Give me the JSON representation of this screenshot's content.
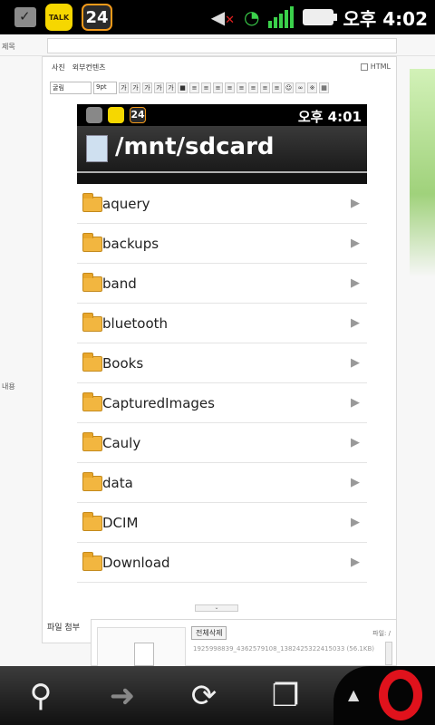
{
  "status_bar": {
    "clock": "오후 4:02",
    "icons": [
      "download-done-icon",
      "kakaotalk-icon",
      "news24-icon",
      "mute-icon",
      "wifi-icon",
      "signal-icon",
      "battery-icon"
    ],
    "talk_label": "TALK",
    "badge_24": "24"
  },
  "form": {
    "title_label": "제목",
    "content_label": "내용",
    "title_value": "",
    "editor_tabs": [
      "사진",
      "외부컨텐츠"
    ],
    "html_label": "HTML",
    "font_select": "굴림",
    "size_select": "9pt"
  },
  "embedded_screenshot": {
    "clock": "오후 4:01",
    "badge_24": "24",
    "path_title": "/mnt/sdcard",
    "folders": [
      "aquery",
      "backups",
      "band",
      "bluetooth",
      "Books",
      "CapturedImages",
      "Cauly",
      "data",
      "DCIM",
      "Download"
    ]
  },
  "attachments": {
    "label": "파일 첨부",
    "delete_all": "전체삭제",
    "file_count": "파일: /",
    "file_name": "1925998839_4362579108_1382425322415033 (56.1KB)"
  },
  "bottom_bar": {
    "buttons": [
      "zoom-back-icon",
      "forward-icon",
      "reload-icon",
      "tabs-icon",
      "opera-menu-icon"
    ]
  },
  "colors": {
    "status_bg": "#000000",
    "accent": "#e0121c",
    "folder": "#f2b640"
  }
}
